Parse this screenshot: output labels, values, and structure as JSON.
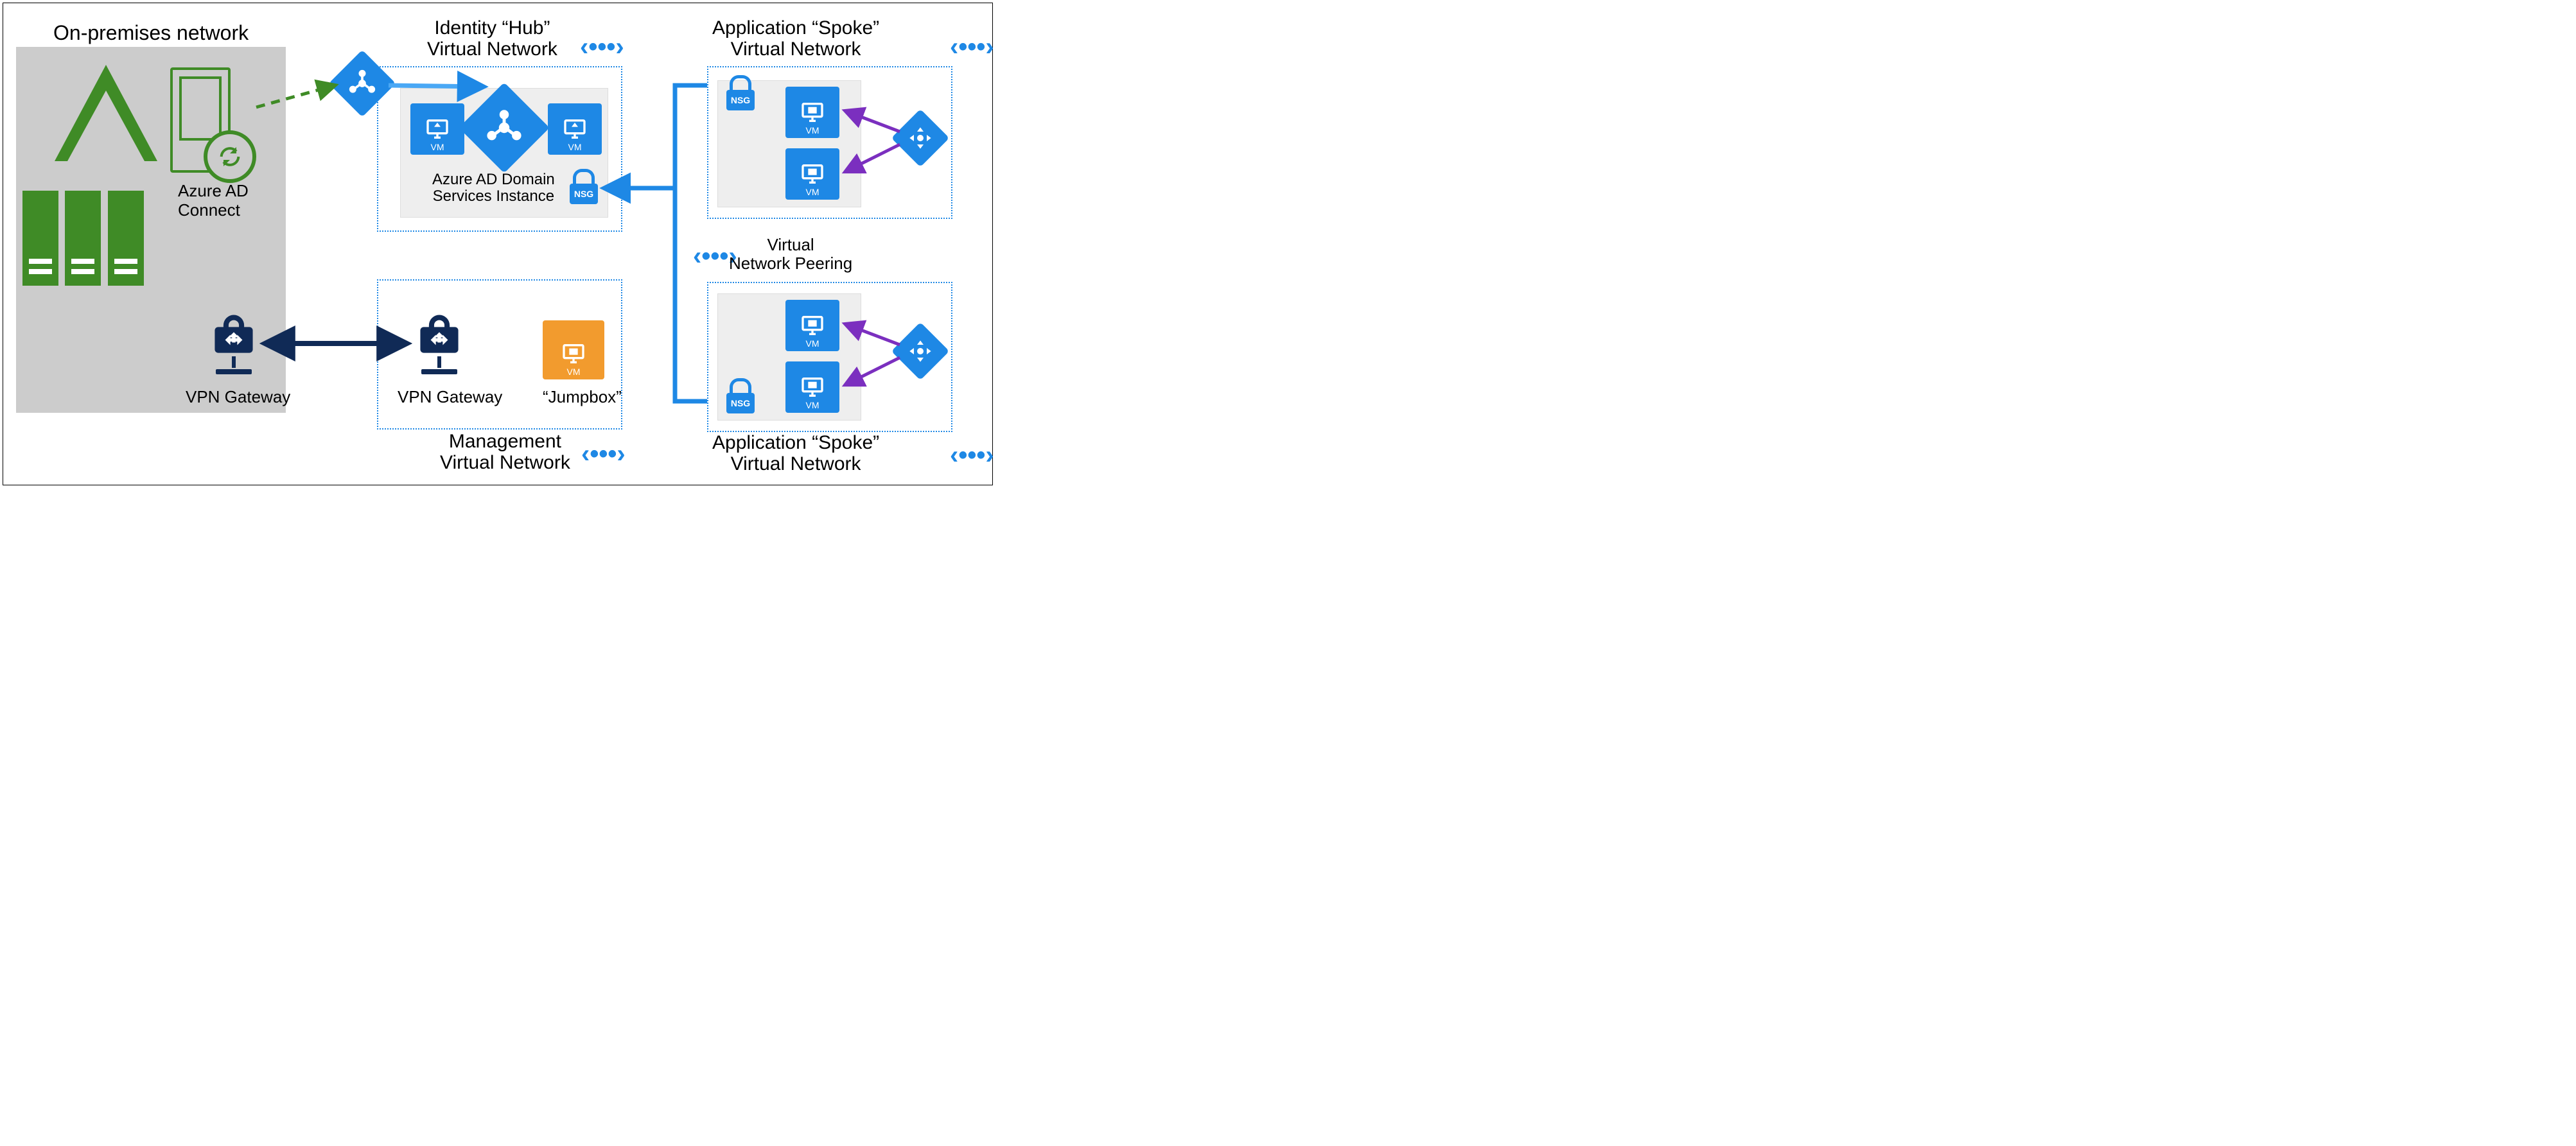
{
  "onprem": {
    "title": "On-premises network",
    "ad_connect_label": "Azure AD\nConnect",
    "vpn_label": "VPN Gateway"
  },
  "hub": {
    "title": "Identity “Hub”\nVirtual Network",
    "group_label": "Azure AD Domain\nServices Instance",
    "vm_label": "VM",
    "nsg_label": "NSG"
  },
  "mgmt": {
    "title": "Management\nVirtual Network",
    "vpn_label": "VPN Gateway",
    "jumpbox_label": "“Jumpbox”",
    "vm_label": "VM"
  },
  "spoke": {
    "title1": "Application “Spoke”\nVirtual Network",
    "title2": "Application “Spoke”\nVirtual Network",
    "vm_label": "VM",
    "nsg_label": "NSG"
  },
  "peering": {
    "glyph": "‹•••›",
    "label": "Virtual\nNetwork Peering"
  },
  "icons": {
    "aad": "azure-ad-icon",
    "vm": "vm-icon",
    "vpn": "vpn-gateway-icon",
    "nsg": "nsg-lock-icon",
    "lb": "load-balancer-icon",
    "server": "server-icon",
    "sync": "sync-icon",
    "peer": "vnet-peering-icon"
  },
  "colors": {
    "azure_blue": "#1e88e5",
    "navy": "#102a56",
    "green": "#3f8b26",
    "orange": "#f29b2e",
    "purple": "#7b2fbf",
    "grey_bg": "#cccccc"
  }
}
